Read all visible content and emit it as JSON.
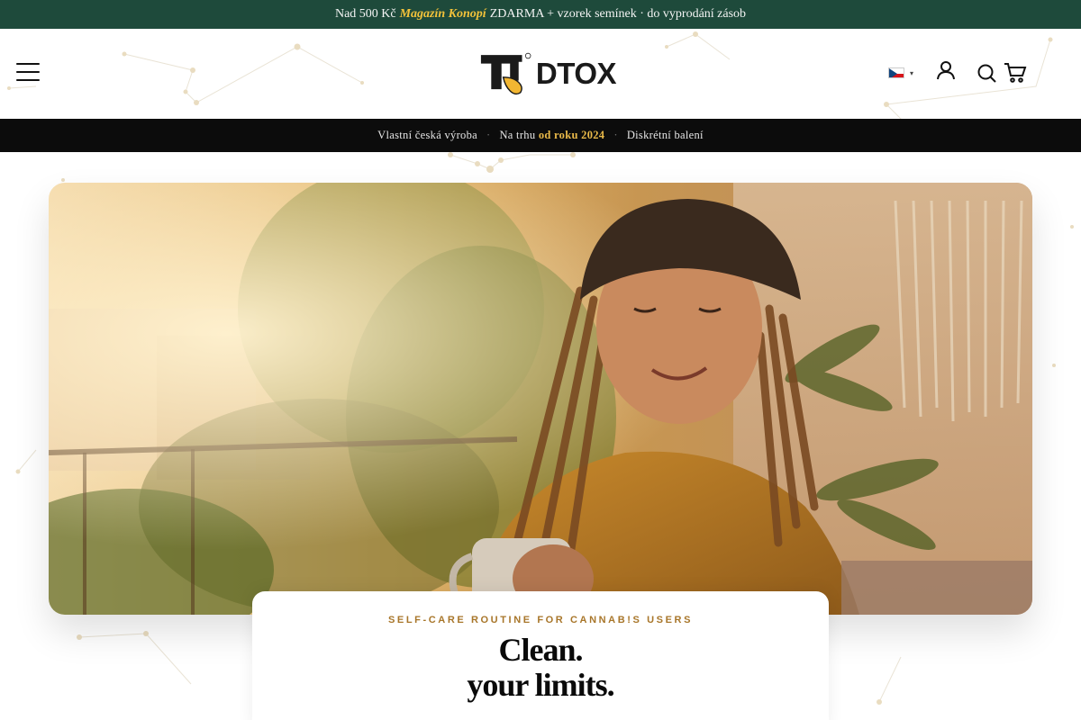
{
  "announcement": {
    "prefix": "Nad 500 Kč",
    "highlight": "Magazín Konopí",
    "suffix": "ZDARMA + vzorek semínek · do vyprodání zásob"
  },
  "header": {
    "brand": "DTOX",
    "icons": {
      "menu": "hamburger-menu-icon",
      "language": "czech-flag-icon",
      "account": "user-icon",
      "search": "search-icon",
      "cart": "cart-icon"
    }
  },
  "usp": {
    "item1": "Vlastní česká výroba",
    "separator": "·",
    "item2_prefix": "Na trhu",
    "item2_highlight": "od roku 2024",
    "item3": "Diskrétní balení"
  },
  "hero": {
    "eyebrow": "SELF-CARE ROUTINE FOR CANNAB!S USERS",
    "headline_line1": "Clean.",
    "headline_line2": "your limits."
  },
  "colors": {
    "announce_bg": "#1e4a3b",
    "announce_highlight": "#f2c23a",
    "usp_bg": "#0c0c0c",
    "usp_highlight": "#e9b949",
    "eyebrow": "#a8762a"
  }
}
